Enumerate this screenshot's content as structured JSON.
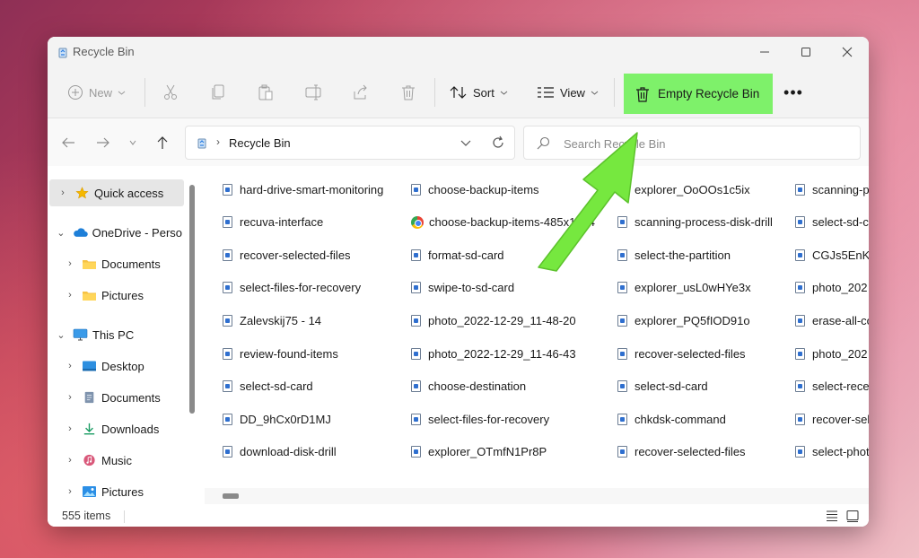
{
  "window": {
    "title": "Recycle Bin"
  },
  "toolbar": {
    "new_label": "New",
    "sort_label": "Sort",
    "view_label": "View",
    "empty_bin_label": "Empty Recycle Bin",
    "more_label": "•••",
    "highlight_color": "#7ef16a"
  },
  "address": {
    "path": "Recycle Bin"
  },
  "search": {
    "placeholder": "Search Recycle Bin"
  },
  "sidebar": {
    "items": [
      {
        "label": "Quick access",
        "icon": "star-icon"
      },
      {
        "label": "OneDrive - Perso",
        "icon": "cloud-icon"
      },
      {
        "label": "Documents",
        "icon": "folder-icon"
      },
      {
        "label": "Pictures",
        "icon": "folder-icon"
      },
      {
        "label": "This PC",
        "icon": "monitor-icon"
      },
      {
        "label": "Desktop",
        "icon": "desktop-icon"
      },
      {
        "label": "Documents",
        "icon": "documents-icon"
      },
      {
        "label": "Downloads",
        "icon": "download-icon"
      },
      {
        "label": "Music",
        "icon": "music-icon"
      },
      {
        "label": "Pictures",
        "icon": "pictures-icon"
      }
    ]
  },
  "files": {
    "col1": [
      "hard-drive-smart-monitoring",
      "recuva-interface",
      "recover-selected-files",
      "select-files-for-recovery",
      "Zalevskij75 - 14",
      "review-found-items",
      "select-sd-card",
      "DD_9hCx0rD1MJ",
      "download-disk-drill"
    ],
    "col2": [
      "choose-backup-items",
      "choose-backup-items-485x1024",
      "format-sd-card",
      "swipe-to-sd-card",
      "photo_2022-12-29_11-48-20",
      "photo_2022-12-29_11-46-43",
      "choose-destination",
      "select-files-for-recovery",
      "explorer_OTmfN1Pr8P"
    ],
    "col3": [
      "explorer_OoOOs1c5ix",
      "scanning-process-disk-drill",
      "select-the-partition",
      "explorer_usL0wHYe3x",
      "explorer_PQ5fIOD91o",
      "recover-selected-files",
      "select-sd-card",
      "chkdsk-command",
      "recover-selected-files"
    ],
    "col4": [
      "scanning-p",
      "select-sd-c",
      "CGJs5EnKli",
      "photo_202",
      "erase-all-co",
      "photo_202",
      "select-recer",
      "recover-sel",
      "select-phot"
    ]
  },
  "status": {
    "items_count": "555 items"
  }
}
